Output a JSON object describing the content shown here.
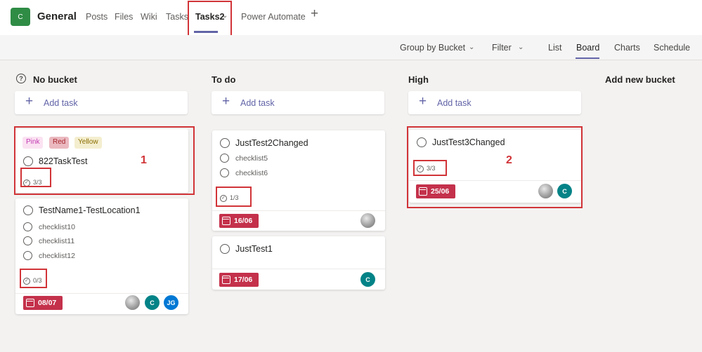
{
  "header": {
    "team_initial": "C",
    "channel": "General",
    "tabs": [
      "Posts",
      "Files",
      "Wiki",
      "Tasks",
      "Tasks2",
      "Power Automate"
    ],
    "add_tab": "+"
  },
  "toolbar": {
    "group_by": "Group by Bucket",
    "filter": "Filter",
    "views": [
      "List",
      "Board",
      "Charts",
      "Schedule"
    ],
    "active_view": "Board"
  },
  "buckets": [
    {
      "title": "No bucket",
      "add_task": "Add task"
    },
    {
      "title": "To do",
      "add_task": "Add task"
    },
    {
      "title": "High",
      "add_task": "Add task"
    },
    {
      "title": "Add new bucket"
    }
  ],
  "cards": {
    "c822": {
      "labels": [
        "Pink",
        "Red",
        "Yellow"
      ],
      "title": "822TaskTest",
      "progress": "3/3"
    },
    "testname": {
      "title": "TestName1-TestLocation1",
      "checklist": [
        "checklist10",
        "checklist11",
        "checklist12"
      ],
      "progress": "0/3",
      "due": "08/07",
      "assignees": [
        "",
        "C",
        "JG"
      ]
    },
    "jt2": {
      "title": "JustTest2Changed",
      "checklist": [
        "checklist5",
        "checklist6"
      ],
      "progress": "1/3",
      "due": "16/06"
    },
    "jt1": {
      "title": "JustTest1",
      "due": "17/06",
      "assignee": "C"
    },
    "jt3": {
      "title": "JustTest3Changed",
      "progress": "3/3",
      "due": "25/06",
      "assignee": "C"
    }
  },
  "annotations": [
    "1",
    "2"
  ],
  "colors": {
    "accent": "#6264a7",
    "team": "#2f8c45",
    "due": "#c4314b",
    "highlight": "#d13438",
    "label_pink": "#fbe2f2",
    "label_red": "#ebb9c0",
    "label_yellow": "#f4eecf"
  }
}
